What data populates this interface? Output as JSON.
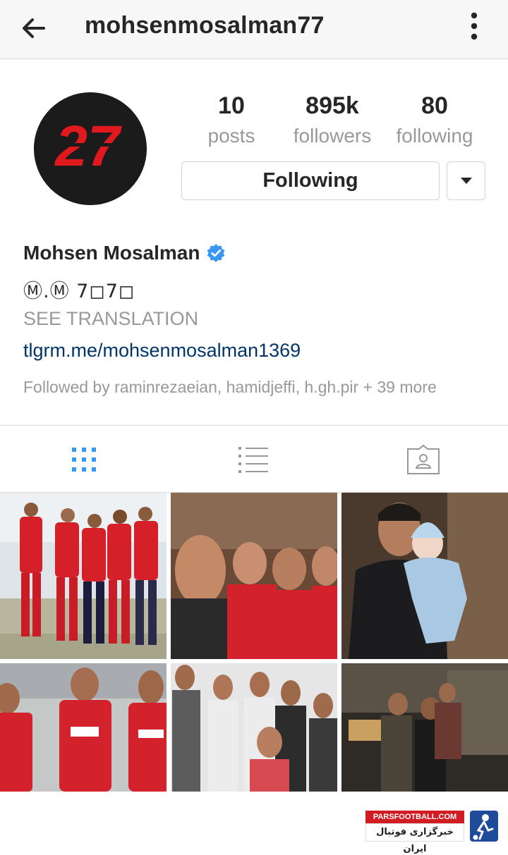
{
  "topbar": {
    "username": "mohsenmosalman77"
  },
  "avatar": {
    "text": "27"
  },
  "stats": [
    {
      "value": "10",
      "label": "posts"
    },
    {
      "value": "895k",
      "label": "followers"
    },
    {
      "value": "80",
      "label": "following"
    }
  ],
  "actions": {
    "follow_label": "Following"
  },
  "profile": {
    "full_name": "Mohsen Mosalman",
    "bio": "Ⓜ.Ⓜ 7◻7◻",
    "see_translation": "SEE TRANSLATION",
    "link": "tlgrm.me/mohsenmosalman1369",
    "followed_by": "Followed by raminrezaeian, hamidjeffi, h.gh.pir + 39 more"
  },
  "icons": {
    "back": "arrow-left-icon",
    "more": "more-vertical-icon",
    "verified": "verified-badge-icon",
    "dropdown": "chevron-down-icon",
    "grid_tab": "grid-icon",
    "list_tab": "list-icon",
    "tagged_tab": "tagged-person-icon"
  },
  "colors": {
    "accent_blue": "#3897f0",
    "avatar_red": "#e0191f",
    "text_muted": "#999999",
    "link": "#003569"
  },
  "watermark": {
    "top": "PARSFOOTBALL.COM",
    "bottom": "خبرگزاری فوتبال ایران"
  }
}
